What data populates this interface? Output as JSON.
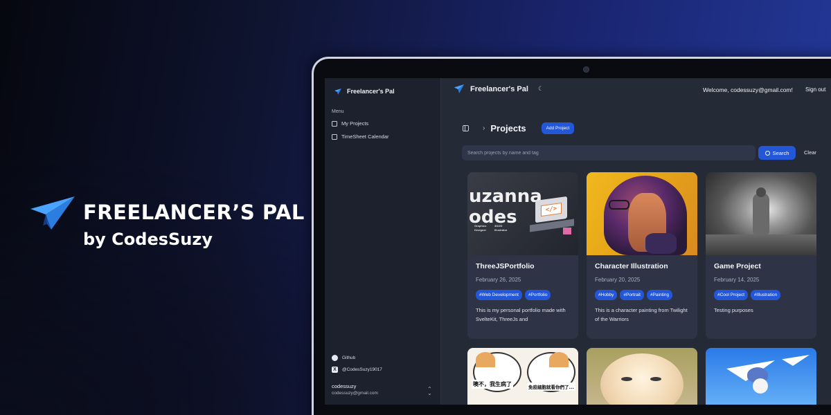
{
  "hero": {
    "title": "FREELANCER’S PAL",
    "subtitle": "by CodesSuzy"
  },
  "sidebar": {
    "brand": "Freelancer's Pal",
    "menu_label": "Menu",
    "items": [
      {
        "label": "My Projects",
        "icon": "image-icon"
      },
      {
        "label": "TimeSheet Calendar",
        "icon": "calendar-icon"
      }
    ],
    "links": [
      {
        "label": "Github",
        "icon": "github-icon"
      },
      {
        "label": "@CodesSuzy19017",
        "icon": "x-icon"
      }
    ],
    "user": {
      "name": "codessuzy",
      "email": "codessuzy@gmail.com"
    }
  },
  "topbar": {
    "brand": "Freelancer's Pal",
    "welcome": "Welcome, codessuzy@gmail.com!",
    "signout": "Sign out"
  },
  "page": {
    "title": "Projects",
    "add_label": "Add Project"
  },
  "search": {
    "placeholder": "Search projects by name and tag",
    "button_label": "Search",
    "clear_label": "Clear"
  },
  "projects": [
    {
      "title": "ThreeJSPortfolio",
      "date": "February 26, 2025",
      "tags": [
        "#Web Development",
        "#Portfolio"
      ],
      "description": "This is my personal portfolio made with SvelteKit, ThreeJs and",
      "thumb_lines": [
        "uzanna",
        "odes"
      ],
      "thumb_small": [
        "Graphics",
        "Designer",
        "3D/2D",
        "Illustrator"
      ]
    },
    {
      "title": "Character Illustration",
      "date": "February 20, 2025",
      "tags": [
        "#Hobby",
        "#Portrait",
        "#Painting"
      ],
      "description": "This is a character painting from Twilight of the Warriors"
    },
    {
      "title": "Game Project",
      "date": "February 14, 2025",
      "tags": [
        "#Cool Project",
        "#Illustration"
      ],
      "description": "Testing purposes"
    }
  ],
  "second_row": {
    "meme_left": "噢不，我生病了",
    "meme_right": "免疫細胞就看你們了..."
  },
  "colors": {
    "accent": "#2457d8",
    "sidebar_bg": "#1d212d",
    "main_bg": "#252a37",
    "card_bg": "#2e3445"
  }
}
